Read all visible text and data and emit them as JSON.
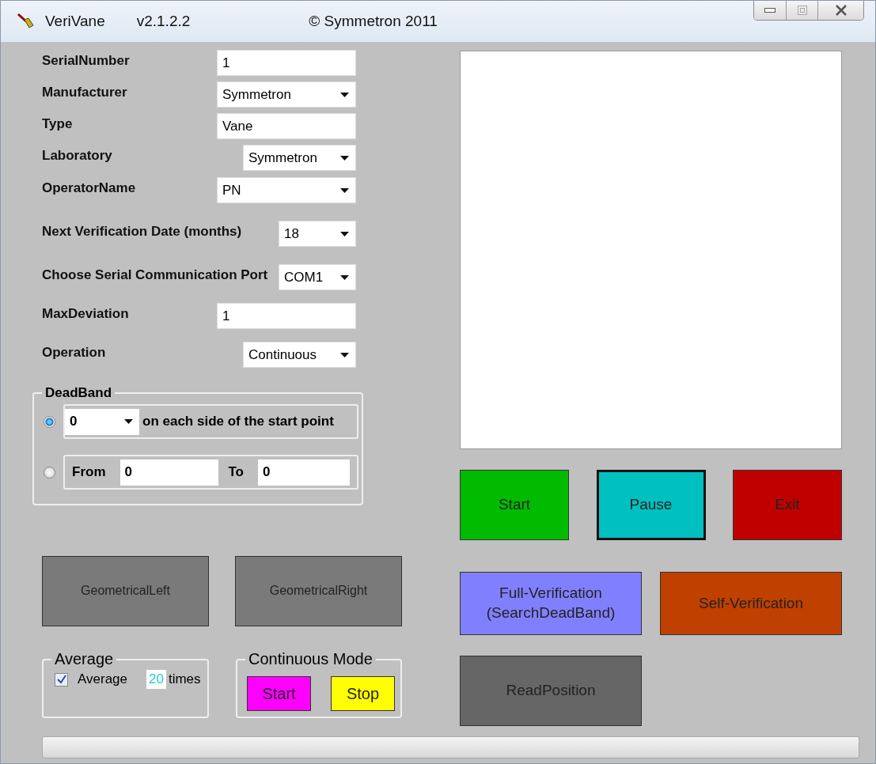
{
  "window": {
    "title": "VeriVane",
    "version": "v2.1.2.2",
    "copyright": "© Symmetron 2011"
  },
  "fields": [
    {
      "label": "SerialNumber",
      "kind": "text",
      "value": "1"
    },
    {
      "label": "Manufacturer",
      "kind": "combo",
      "value": "Symmetron"
    },
    {
      "label": "Type",
      "kind": "text",
      "value": "Vane"
    },
    {
      "label": "Laboratory",
      "kind": "combo",
      "value": "Symmetron"
    },
    {
      "label": "OperatorName",
      "kind": "combo",
      "value": "PN"
    },
    {
      "label": "Next Verification Date (months)",
      "kind": "combo",
      "value": "18"
    },
    {
      "label": "Choose Serial Communication Port",
      "kind": "combo",
      "value": "COM1"
    },
    {
      "label": "MaxDeviation",
      "kind": "text",
      "value": "1"
    },
    {
      "label": "Operation",
      "kind": "combo",
      "value": "Continuous"
    }
  ],
  "deadband": {
    "title": "DeadBand",
    "options": [
      {
        "selected": true,
        "value": "0",
        "text": "on each side of the start point"
      },
      {
        "selected": false,
        "from_label": "From",
        "from": "0",
        "to_label": "To",
        "to": "0"
      }
    ]
  },
  "geometry_buttons": [
    {
      "label": "GeometricalLeft",
      "color": "#7a7a7a"
    },
    {
      "label": "GeometricalRight",
      "color": "#7a7a7a"
    }
  ],
  "average": {
    "title": "Average",
    "checked": true,
    "label": "Average",
    "count": "20",
    "unit": "times"
  },
  "continuous_mode": {
    "title": "Continuous Mode",
    "buttons": [
      {
        "label": "Start",
        "color": "#ff00ff"
      },
      {
        "label": "Stop",
        "color": "#ffff00"
      }
    ]
  },
  "control_buttons": [
    {
      "label": "Start",
      "color": "#00bb00",
      "focused": false
    },
    {
      "label": "Pause",
      "color": "#00c0c0",
      "focused": true
    },
    {
      "label": "Exit",
      "color": "#c00000",
      "focused": false
    }
  ],
  "verification_buttons": [
    {
      "label": "Full-Verification\n(SearchDeadBand)",
      "color": "#8080ff"
    },
    {
      "label": "Self-Verification",
      "color": "#c04000"
    }
  ],
  "read_button": {
    "label": "ReadPosition",
    "color": "#666666"
  },
  "progress": {
    "level": 0
  }
}
